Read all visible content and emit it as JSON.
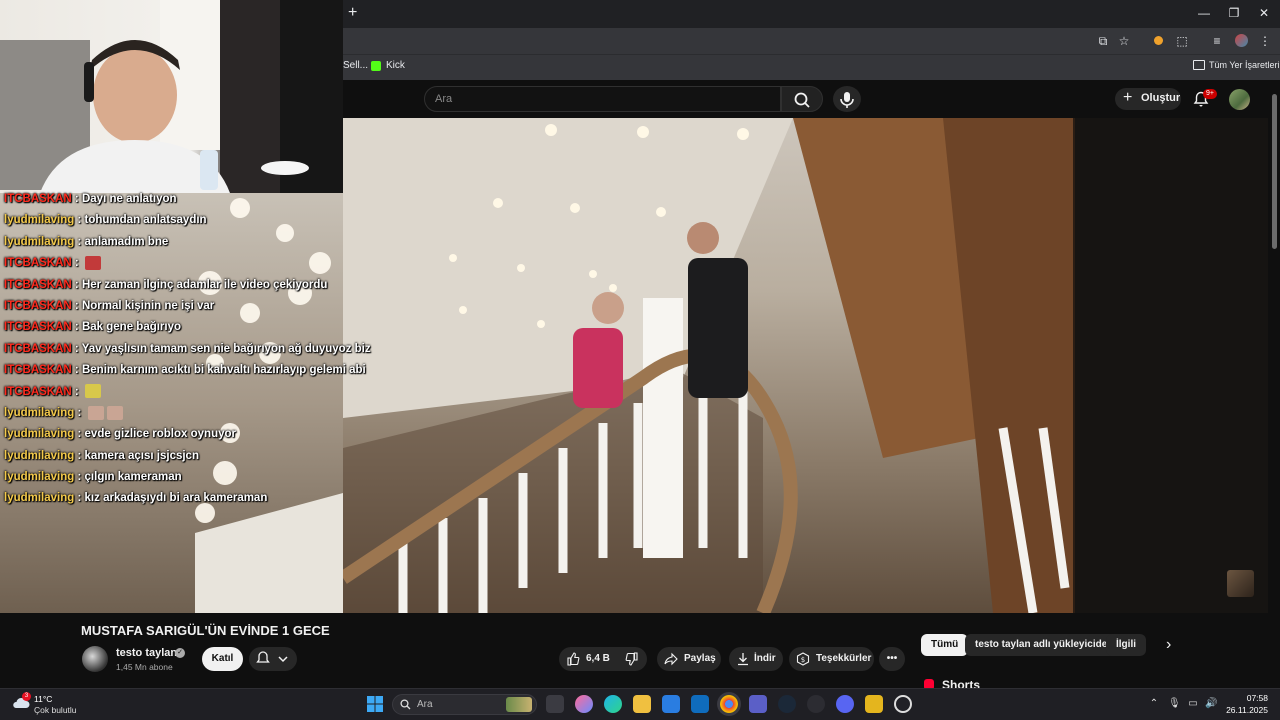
{
  "browser": {
    "new_tab": "+",
    "window_min": "—",
    "window_max": "❐",
    "window_close": "✕",
    "bookmarks": [
      "Sell...",
      "Kick"
    ],
    "bookmarks_all": "Tüm Yer İşaretleri"
  },
  "youtube": {
    "search_placeholder": "Ara",
    "create_label": "Oluştur",
    "notif_count": "9+"
  },
  "stream_chat": {
    "messages": [
      {
        "user": "ITCBASKAN",
        "text": "Dayı ne anlatıyon",
        "user_color": "#ff2a1e"
      },
      {
        "user": "lyudmilaving",
        "text": "tohumdan anlatsaydın",
        "user_color": "#f3c94b"
      },
      {
        "user": "lyudmilaving",
        "text": "anlamadım bne",
        "user_color": "#f3c94b"
      },
      {
        "user": "ITCBASKAN",
        "text": "",
        "user_color": "#ff2a1e",
        "emotes": [
          "emote"
        ]
      },
      {
        "user": "ITCBASKAN",
        "text": "Her zaman ilginç adamlar ile video çekiyordu",
        "user_color": "#ff2a1e"
      },
      {
        "user": "ITCBASKAN",
        "text": "Normal kişinin ne işi var",
        "user_color": "#ff2a1e"
      },
      {
        "user": "ITCBASKAN",
        "text": "Bak gene bağırıyo",
        "user_color": "#ff2a1e"
      },
      {
        "user": "ITCBASKAN",
        "text": "Yav yaşlısın tamam sen nie bağırıyon ağ duyuyoz biz",
        "user_color": "#ff2a1e"
      },
      {
        "user": "ITCBASKAN",
        "text": "Benim karnım acıktı bi kahvaltı hazırlayıp gelemi abi",
        "user_color": "#ff2a1e"
      },
      {
        "user": "ITCBASKAN",
        "text": "",
        "user_color": "#ff2a1e",
        "emotes": [
          "emote"
        ]
      },
      {
        "user": "lyudmilaving",
        "text": "",
        "user_color": "#f3c94b",
        "emotes": [
          "emote",
          "emote"
        ]
      },
      {
        "user": "lyudmilaving",
        "text": "evde gizlice roblox oynuyor",
        "user_color": "#f3c94b"
      },
      {
        "user": "lyudmilaving",
        "text": "kamera açısı jsjcsjcn",
        "user_color": "#f3c94b"
      },
      {
        "user": "lyudmilaving",
        "text": "çılgın kameraman",
        "user_color": "#f3c94b"
      },
      {
        "user": "lyudmilaving",
        "text": "kız arkadaşıydı bi ara kameraman",
        "user_color": "#f3c94b"
      }
    ]
  },
  "video": {
    "title": "MUSTAFA SARIGÜL'ÜN EVİNDE 1 GECE",
    "channel": "testo taylan",
    "subscribers": "1,45 Mn abone",
    "join_label": "Katıl",
    "likes": "6,4 B",
    "share_label": "Paylaş",
    "download_label": "İndir",
    "thanks_label": "Teşekkürler"
  },
  "sidebar": {
    "chips": [
      "Tümü",
      "testo taylan adlı yükleyiciden",
      "İlgili"
    ],
    "shorts_label": "Shorts"
  },
  "taskbar": {
    "weather_badge": "3",
    "temperature": "11°C",
    "weather_text": "Çok bulutlu",
    "search_placeholder": "Ara",
    "time": "07:58",
    "date": "26.11.2025"
  },
  "colors": {
    "accent_red": "#ff0033",
    "chat_user_red": "#ff2a1e",
    "chat_user_yellow": "#f3c94b"
  }
}
